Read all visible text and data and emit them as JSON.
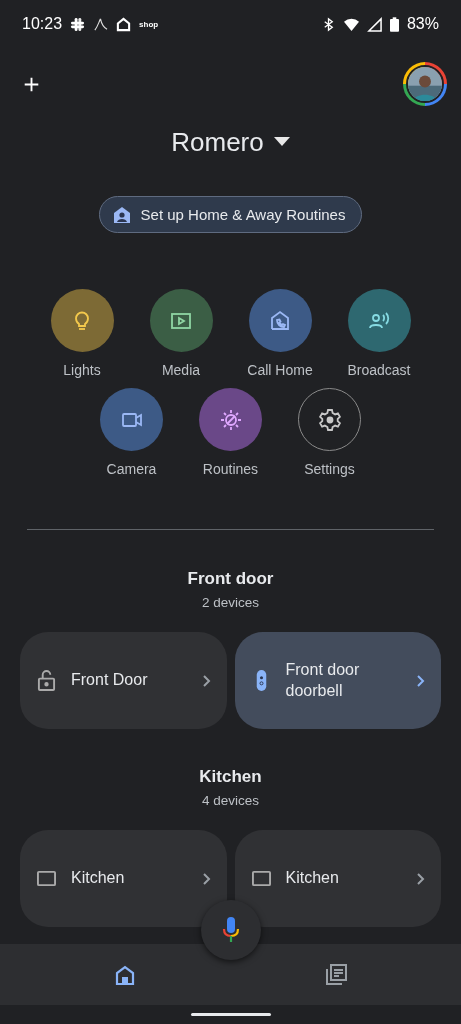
{
  "status_bar": {
    "time": "10:23",
    "notification_text": "shop",
    "battery": "83%"
  },
  "home": {
    "name": "Romero"
  },
  "routines_chip": {
    "label": "Set up Home & Away Routines"
  },
  "shortcuts": [
    {
      "label": "Lights",
      "kind": "filled",
      "color": "#7d6a35"
    },
    {
      "label": "Media",
      "kind": "filled",
      "color": "#3b5e45"
    },
    {
      "label": "Call Home",
      "kind": "filled",
      "color": "#3d5a86"
    },
    {
      "label": "Broadcast",
      "kind": "filled",
      "color": "#2e6870"
    },
    {
      "label": "Camera",
      "kind": "filled",
      "color": "#3d5a86"
    },
    {
      "label": "Routines",
      "kind": "filled",
      "color": "#6a4888"
    },
    {
      "label": "Settings",
      "kind": "outline"
    }
  ],
  "rooms": [
    {
      "name": "Front door",
      "count": "2 devices",
      "devices": [
        {
          "name": "Front Door",
          "active": false
        },
        {
          "name": "Front door doorbell",
          "active": true
        }
      ]
    },
    {
      "name": "Kitchen",
      "count": "4 devices",
      "devices": [
        {
          "name": "Kitchen",
          "active": false
        },
        {
          "name": "Kitchen",
          "active": false
        }
      ]
    }
  ],
  "bottom_nav": [
    {
      "selected": true
    },
    {
      "selected": false
    }
  ]
}
